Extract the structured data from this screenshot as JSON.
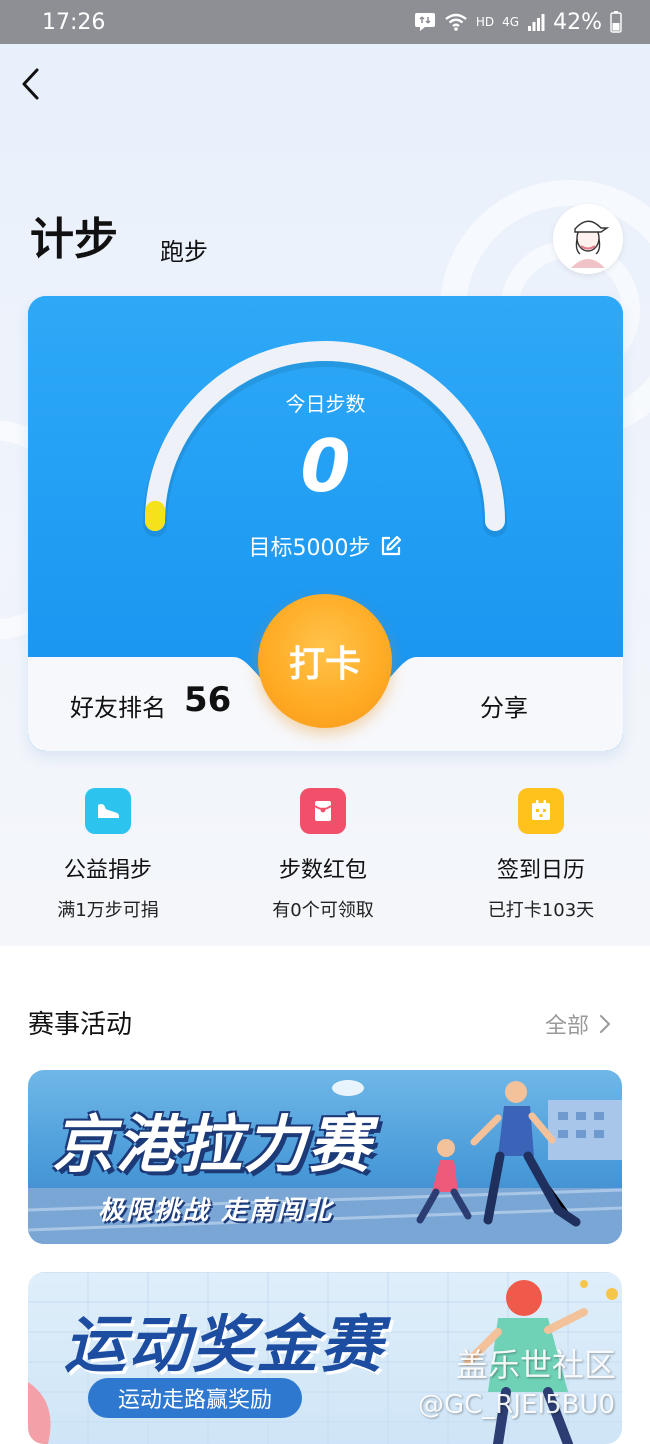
{
  "status_bar": {
    "time": "17:26",
    "network": "HD",
    "signal": "4G",
    "battery": "42%"
  },
  "header": {
    "title": "计步",
    "subtitle": "跑步"
  },
  "step_card": {
    "today_label": "今日步数",
    "today_steps": "0",
    "goal_text": "目标5000步",
    "progress": 0,
    "checkin_label": "打卡",
    "rank_label": "好友排名",
    "rank_value": "56",
    "share_label": "分享"
  },
  "shortcuts": [
    {
      "title": "公益捐步",
      "sub": "满1万步可捐",
      "icon": "shoe-icon",
      "color": "#2cc3ee"
    },
    {
      "title": "步数红包",
      "sub": "有0个可领取",
      "icon": "red-envelope-icon",
      "color": "#f2506a"
    },
    {
      "title": "签到日历",
      "sub": "已打卡103天",
      "icon": "calendar-icon",
      "color": "#ffc21c"
    }
  ],
  "events": {
    "title": "赛事活动",
    "all_label": "全部",
    "banners": [
      {
        "title": "京港拉力赛",
        "sub": "极限挑战 走南闯北"
      },
      {
        "title": "运动奖金赛",
        "sub": "运动走路赢奖励"
      }
    ]
  },
  "watermark": {
    "line1": "盖乐世社区",
    "line2": "@GC_RJEI5BU0"
  },
  "colors": {
    "accent_blue": "#1f9bf3",
    "checkin_orange": "#ffaa23",
    "progress_yellow": "#f5e21a"
  }
}
